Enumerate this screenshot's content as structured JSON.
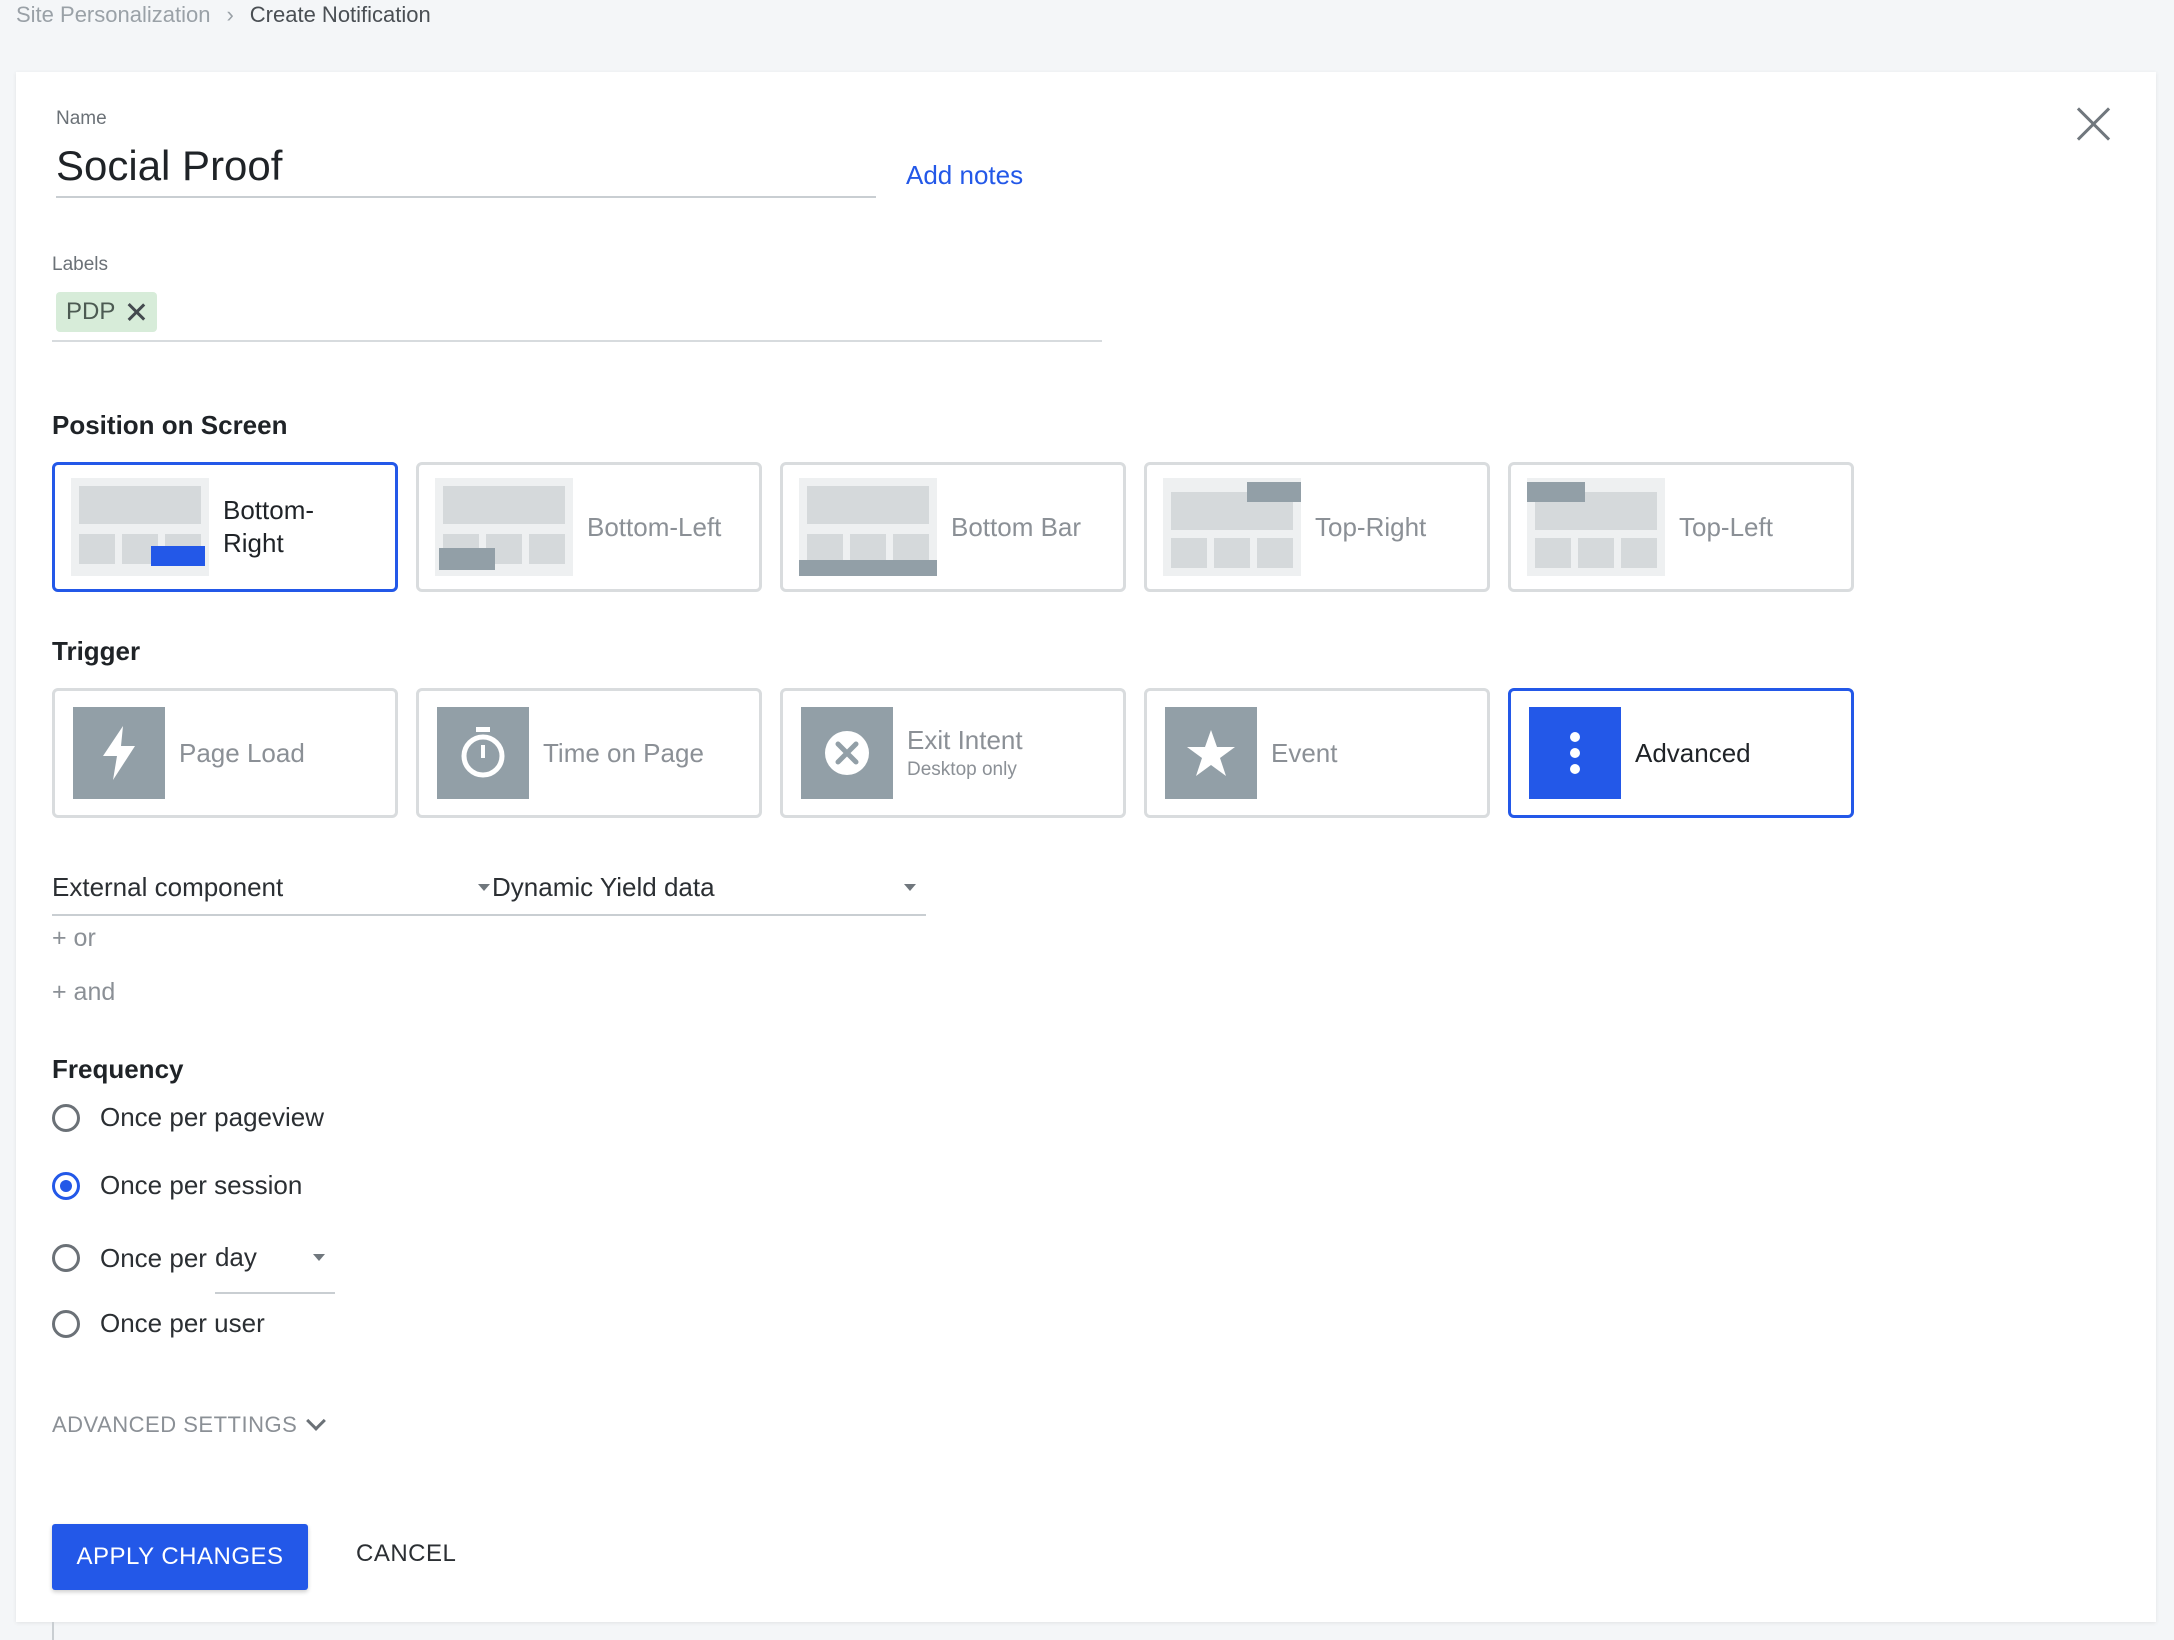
{
  "breadcrumb": {
    "root": "Site Personalization",
    "separator": "›",
    "current": "Create Notification"
  },
  "name": {
    "label": "Name",
    "value": "Social Proof",
    "add_notes": "Add notes"
  },
  "labels": {
    "label": "Labels",
    "chips": [
      "PDP"
    ]
  },
  "position": {
    "title": "Position on Screen",
    "selected": "Bottom-Right",
    "options": [
      {
        "label": "Bottom-\nRight",
        "key": "bottom-right"
      },
      {
        "label": "Bottom-Left",
        "key": "bottom-left"
      },
      {
        "label": "Bottom Bar",
        "key": "bottom-bar"
      },
      {
        "label": "Top-Right",
        "key": "top-right"
      },
      {
        "label": "Top-Left",
        "key": "top-left"
      }
    ]
  },
  "trigger": {
    "title": "Trigger",
    "selected": "Advanced",
    "options": [
      {
        "label": "Page Load",
        "icon": "lightning-icon"
      },
      {
        "label": "Time on Page",
        "icon": "stopwatch-icon"
      },
      {
        "label": "Exit Intent",
        "sublabel": "Desktop only",
        "icon": "x-circle-icon"
      },
      {
        "label": "Event",
        "icon": "star-icon"
      },
      {
        "label": "Advanced",
        "icon": "vertical-dots-icon"
      }
    ]
  },
  "conditions": {
    "select1": "External component",
    "select2": "Dynamic Yield data",
    "or_link": "+ or",
    "and_link": "+ and"
  },
  "frequency": {
    "title": "Frequency",
    "selected": "Once per session",
    "options": [
      "Once per pageview",
      "Once per session",
      "Once per",
      "Once per user"
    ],
    "period_value": "day"
  },
  "advanced_settings": "ADVANCED SETTINGS",
  "actions": {
    "apply": "APPLY CHANGES",
    "cancel": "CANCEL"
  },
  "colors": {
    "accent": "#2358e8",
    "icon_gray": "#929fa7",
    "chip_bg": "#d7ecd9"
  }
}
